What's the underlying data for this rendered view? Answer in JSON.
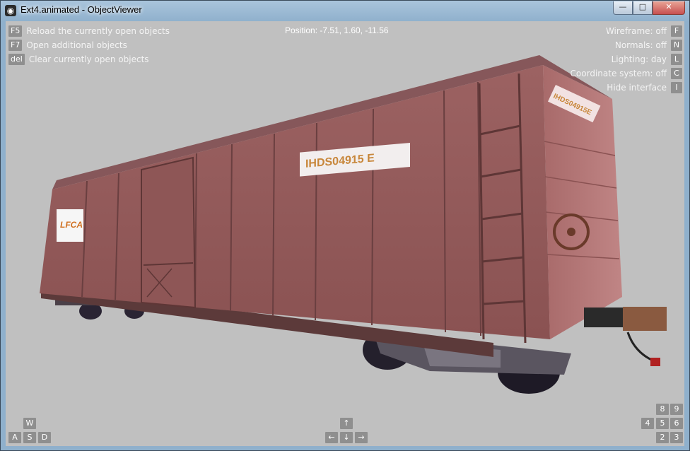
{
  "window": {
    "title": "Ext4.animated - ObjectViewer",
    "minimize": "—",
    "maximize": "□",
    "close": "✕",
    "icon": "viewer-app-icon"
  },
  "hud_left": [
    {
      "key": "F5",
      "label": "Reload the currently open objects"
    },
    {
      "key": "F7",
      "label": "Open additional objects"
    },
    {
      "key": "del",
      "label": "Clear currently open objects"
    }
  ],
  "position": "Position: -7.51, 1.60, -11.56",
  "hud_right": [
    {
      "key": "F",
      "label": "Wireframe: off"
    },
    {
      "key": "N",
      "label": "Normals: off"
    },
    {
      "key": "L",
      "label": "Lighting: day"
    },
    {
      "key": "C",
      "label": "Coordinate system: off"
    },
    {
      "key": "I",
      "label": "Hide interface"
    }
  ],
  "wasd": {
    "w": "W",
    "a": "A",
    "s": "S",
    "d": "D"
  },
  "arrows": {
    "up": "↑",
    "left": "←",
    "down": "↓",
    "right": "→"
  },
  "numpad": {
    "n8": "8",
    "n9": "9",
    "n4": "4",
    "n5": "5",
    "n6": "6",
    "n2": "2",
    "n3": "3"
  },
  "boxcar": {
    "reporting_mark": "IHDS04915 E",
    "end_mark": "IHDS04915E",
    "logo_text": "LFCA",
    "body_color": "#9a5f5f",
    "body_dark": "#6e4040",
    "end_color": "#b07272",
    "roof_color": "#86575a",
    "label_color": "#c8873b"
  },
  "colors": {
    "viewport_bg": "#c0c0c0",
    "key_bg": "#8f8f8f",
    "hud_text": "#ffffff"
  }
}
